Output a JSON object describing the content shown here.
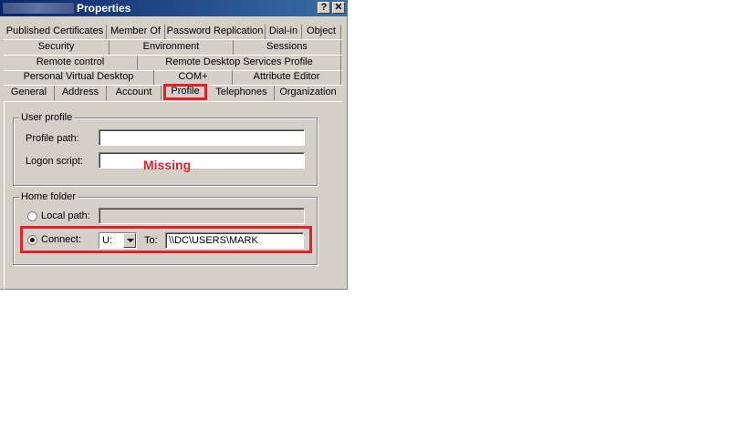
{
  "window": {
    "title": "Properties",
    "help_glyph": "?",
    "close_glyph": "✕"
  },
  "tabs": {
    "row1": [
      "Published Certificates",
      "Member Of",
      "Password Replication",
      "Dial-in",
      "Object"
    ],
    "row2": [
      "Security",
      "Environment",
      "Sessions"
    ],
    "row3": [
      "Remote control",
      "Remote Desktop Services Profile"
    ],
    "row4": [
      "Personal Virtual Desktop",
      "COM+",
      "Attribute Editor"
    ],
    "row5": [
      "General",
      "Address",
      "Account",
      "Profile",
      "Telephones",
      "Organization"
    ],
    "active": "Profile"
  },
  "user_profile": {
    "group_label": "User profile",
    "profile_path_label": "Profile path:",
    "profile_path_value": "",
    "logon_script_label": "Logon script:",
    "logon_script_value": ""
  },
  "home_folder": {
    "group_label": "Home folder",
    "local_path_label": "Local path:",
    "local_path_value": "",
    "connect_label": "Connect:",
    "drive_value": "U:",
    "to_label": "To:",
    "to_value": "\\\\DC\\USERS\\MARK",
    "selected": "connect"
  },
  "annotation": {
    "missing_text": "Missing",
    "color": "#e0202a"
  }
}
